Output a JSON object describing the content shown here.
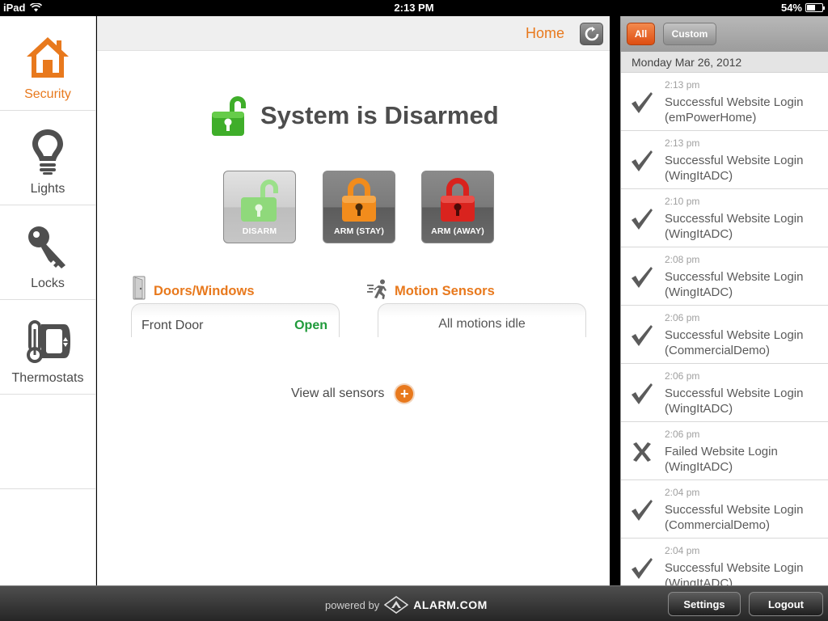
{
  "status_bar": {
    "device": "iPad",
    "time": "2:13 PM",
    "battery": "54%",
    "battery_level": 0.54
  },
  "sidebar": {
    "items": [
      {
        "label": "Security",
        "icon": "home-icon",
        "active": true
      },
      {
        "label": "Lights",
        "icon": "lightbulb-icon",
        "active": false
      },
      {
        "label": "Locks",
        "icon": "key-icon",
        "active": false
      },
      {
        "label": "Thermostats",
        "icon": "thermostat-icon",
        "active": false
      }
    ]
  },
  "header": {
    "home_label": "Home",
    "refresh_icon": "refresh-icon"
  },
  "security": {
    "status_text": "System is Disarmed",
    "status_icon": "unlocked-padlock-icon",
    "buttons": {
      "disarm": "DISARM",
      "arm_stay": "ARM (STAY)",
      "arm_away": "ARM (AWAY)"
    },
    "doors": {
      "title": "Doors/Windows",
      "name": "Front Door",
      "state": "Open"
    },
    "motion": {
      "title": "Motion Sensors",
      "text": "All motions idle"
    },
    "view_all": "View all sensors"
  },
  "events": {
    "filters": {
      "all": "All",
      "custom": "Custom"
    },
    "date": "Monday Mar 26, 2012",
    "items": [
      {
        "time": "2:13 pm",
        "line1": "Successful Website Login",
        "line2": "(emPowerHome)",
        "icon": "check"
      },
      {
        "time": "2:13 pm",
        "line1": "Successful Website Login",
        "line2": "(WingItADC)",
        "icon": "check"
      },
      {
        "time": "2:10 pm",
        "line1": "Successful Website Login",
        "line2": "(WingItADC)",
        "icon": "check"
      },
      {
        "time": "2:08 pm",
        "line1": "Successful Website Login",
        "line2": "(WingItADC)",
        "icon": "check"
      },
      {
        "time": "2:06 pm",
        "line1": "Successful Website Login",
        "line2": "(CommercialDemo)",
        "icon": "check"
      },
      {
        "time": "2:06 pm",
        "line1": "Successful Website Login",
        "line2": "(WingItADC)",
        "icon": "check"
      },
      {
        "time": "2:06 pm",
        "line1": "Failed Website Login",
        "line2": "(WingItADC)",
        "icon": "cross"
      },
      {
        "time": "2:04 pm",
        "line1": "Successful Website Login",
        "line2": "(CommercialDemo)",
        "icon": "check"
      },
      {
        "time": "2:04 pm",
        "line1": "Successful Website Login",
        "line2": "(WingItADC)",
        "icon": "check"
      }
    ]
  },
  "footer": {
    "powered_by": "powered by",
    "brand": "ALARM.COM",
    "settings": "Settings",
    "logout": "Logout"
  },
  "colors": {
    "accent": "#e8791d",
    "open_state": "#1f9a3a",
    "disarmed": "#3fae2a",
    "arm_stay": "#f28c1c",
    "arm_away": "#d9231e"
  }
}
